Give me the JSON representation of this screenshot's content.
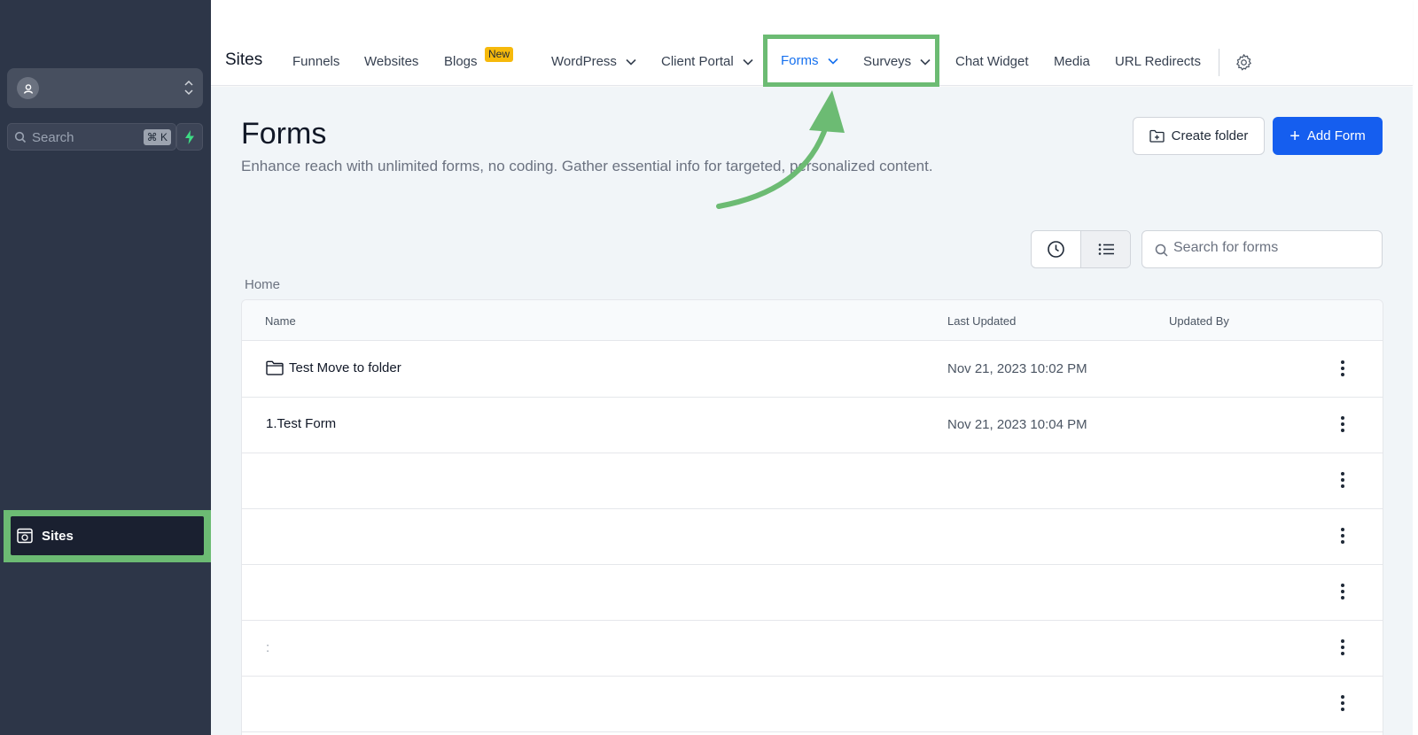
{
  "sidebar": {
    "search_label": "Search",
    "search_shortcut": "⌘ K",
    "sites_label": "Sites"
  },
  "topnav": {
    "title": "Sites",
    "items": [
      {
        "label": "Funnels"
      },
      {
        "label": "Websites"
      },
      {
        "label": "Blogs",
        "badge": "New"
      },
      {
        "label": "WordPress"
      },
      {
        "label": "Client Portal"
      },
      {
        "label": "Forms"
      },
      {
        "label": "Surveys"
      },
      {
        "label": "Chat Widget"
      },
      {
        "label": "Media"
      },
      {
        "label": "URL Redirects"
      }
    ]
  },
  "page": {
    "title": "Forms",
    "description": "Enhance reach with unlimited forms, no coding. Gather essential info for targeted, personalized content.",
    "create_folder_label": "Create folder",
    "add_form_label": "Add Form",
    "search_placeholder": "Search for forms",
    "breadcrumb": "Home"
  },
  "table": {
    "columns": [
      "Name",
      "Last Updated",
      "Updated By"
    ],
    "rows": [
      {
        "name": "Test Move to folder",
        "last_updated": "Nov 21, 2023 10:02 PM",
        "updated_by": "",
        "type": "folder"
      },
      {
        "name": "1.Test Form",
        "last_updated": "Nov 21, 2023 10:04 PM",
        "updated_by": "",
        "type": "form"
      },
      {
        "name": "",
        "last_updated": "",
        "updated_by": ""
      },
      {
        "name": "",
        "last_updated": "",
        "updated_by": ""
      },
      {
        "name": "",
        "last_updated": "",
        "updated_by": ""
      },
      {
        "name": ":",
        "last_updated": "",
        "updated_by": ""
      },
      {
        "name": "",
        "last_updated": "",
        "updated_by": ""
      }
    ]
  },
  "colors": {
    "sidebar_bg": "#2d3648",
    "accent_blue": "#155eef",
    "active_nav": "#1570ef",
    "highlight_green": "#6cbb73",
    "badge_yellow": "#f6b90b"
  }
}
